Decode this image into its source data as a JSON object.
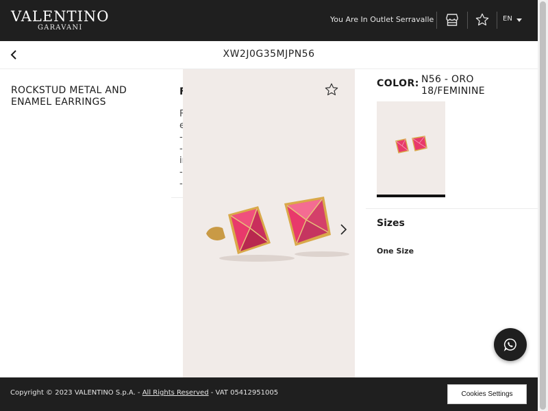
{
  "header": {
    "logo_main": "VALENTINO",
    "logo_sub": "GARAVANI",
    "outlet_text": "You Are In Outlet Serravalle",
    "language": "EN",
    "icons": [
      "store-icon",
      "star-icon"
    ]
  },
  "subheader": {
    "sku": "XW2J0G35MJPN56",
    "back_icon": "chevron-left-icon"
  },
  "product": {
    "name": "ROCKSTUD METAL AND ENAMEL EARRINGS",
    "details_title": "F",
    "details_lines": "F\ne\n-\n-\nir\n-\n-"
  },
  "color": {
    "label": "COLOR:",
    "value": "N56 - ORO 18/FEMININE"
  },
  "sizes": {
    "title": "Sizes",
    "value": "One Size"
  },
  "footer": {
    "copyright_prefix": "Copyright © 2023 VALENTINO S.p.A. - ",
    "rights_link": "All Rights Reserved",
    "vat": " - VAT 05412951005",
    "cookies_button": "Cookies Settings"
  },
  "colors": {
    "header_bg": "#1f1f1f",
    "image_bg": "#f1ebe8",
    "enamel_pink": "#e8396b",
    "gold": "#d9a94a"
  }
}
